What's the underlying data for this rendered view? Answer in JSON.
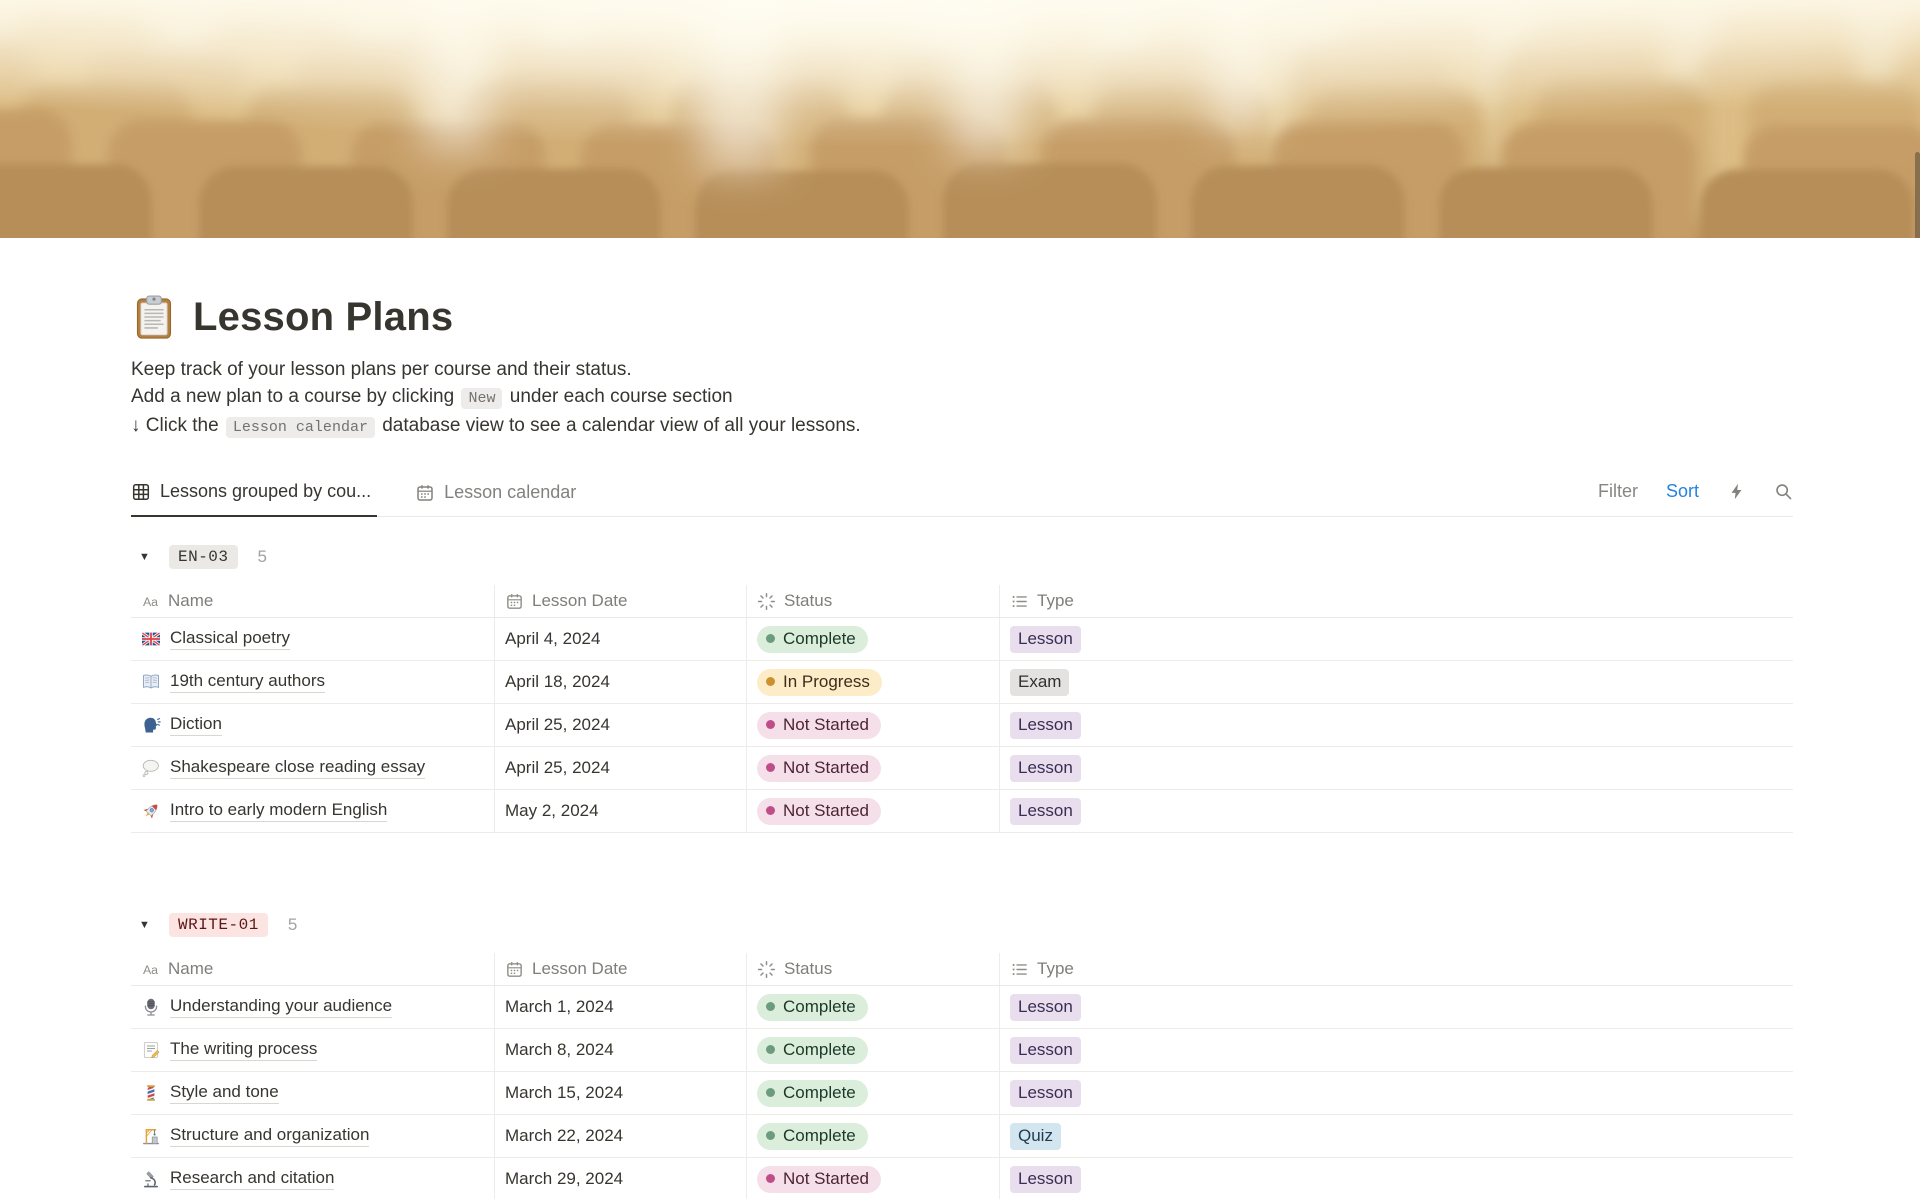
{
  "page": {
    "icon": "clipboard",
    "title": "Lesson Plans",
    "description": [
      [
        {
          "t": "Keep track of your lesson plans per course and their status."
        }
      ],
      [
        {
          "t": "Add a new plan to a course by clicking "
        },
        {
          "c": "New"
        },
        {
          "t": " under each course section"
        }
      ],
      [
        {
          "t": "↓ Click the "
        },
        {
          "c": "Lesson calendar"
        },
        {
          "t": " database view to see a calendar view of all your lessons."
        }
      ]
    ]
  },
  "view_tabs": [
    {
      "label": "Lessons grouped by cou...",
      "icon": "table-icon",
      "active": true
    },
    {
      "label": "Lesson calendar",
      "icon": "calendar-icon",
      "active": false
    }
  ],
  "toolbar": {
    "filter_label": "Filter",
    "sort_label": "Sort",
    "sort_color": "#2383E2",
    "action_icons": [
      "bolt-icon",
      "search-icon"
    ]
  },
  "table_columns": [
    {
      "label": "Name",
      "icon": "text-icon"
    },
    {
      "label": "Lesson Date",
      "icon": "calendar-icon"
    },
    {
      "label": "Status",
      "icon": "status-icon"
    },
    {
      "label": "Type",
      "icon": "list-icon"
    }
  ],
  "status_styles": {
    "Complete": {
      "bg": "#DBEDDB",
      "dot": "#6C9B7D",
      "text": "#1C3829"
    },
    "In Progress": {
      "bg": "#FDECC8",
      "dot": "#CB912F",
      "text": "#402C1B"
    },
    "Not Started": {
      "bg": "#F5E0E9",
      "dot": "#C14C8A",
      "text": "#4C2337"
    }
  },
  "type_styles": {
    "Lesson": {
      "bg": "#E8DEEE",
      "text": "#3D2C52"
    },
    "Exam": {
      "bg": "#E3E2E0",
      "text": "#32302C"
    },
    "Quiz": {
      "bg": "#D3E5EF",
      "text": "#1D3B52"
    }
  },
  "groups": [
    {
      "name": "EN-03",
      "chip_bg": "#EAE9E6",
      "chip_color": "#37352F",
      "count": "5",
      "rows": [
        {
          "icon": "flag-uk-emoji",
          "name": "Classical poetry",
          "date": "April 4, 2024",
          "status": "Complete",
          "type": "Lesson"
        },
        {
          "icon": "open-book-emoji",
          "name": "19th century authors",
          "date": "April 18, 2024",
          "status": "In Progress",
          "type": "Exam"
        },
        {
          "icon": "speaking-head-emoji",
          "name": "Diction",
          "date": "April 25, 2024",
          "status": "Not Started",
          "type": "Lesson"
        },
        {
          "icon": "thought-balloon-emoji",
          "name": "Shakespeare close reading essay",
          "date": "April 25, 2024",
          "status": "Not Started",
          "type": "Lesson"
        },
        {
          "icon": "rocket-emoji",
          "name": "Intro to early modern English",
          "date": "May 2, 2024",
          "status": "Not Started",
          "type": "Lesson"
        }
      ]
    },
    {
      "name": "WRITE-01",
      "chip_bg": "#FBE4E1",
      "chip_color": "#5D1715",
      "count": "5",
      "rows": [
        {
          "icon": "microphone-emoji",
          "name": "Understanding your audience",
          "date": "March 1, 2024",
          "status": "Complete",
          "type": "Lesson"
        },
        {
          "icon": "memo-emoji",
          "name": "The writing process",
          "date": "March 8, 2024",
          "status": "Complete",
          "type": "Lesson"
        },
        {
          "icon": "barber-pole-emoji",
          "name": "Style and tone",
          "date": "March 15, 2024",
          "status": "Complete",
          "type": "Lesson"
        },
        {
          "icon": "crane-emoji",
          "name": "Structure and organization",
          "date": "March 22, 2024",
          "status": "Complete",
          "type": "Quiz"
        },
        {
          "icon": "microscope-emoji",
          "name": "Research and citation",
          "date": "March 29, 2024",
          "status": "Not Started",
          "type": "Lesson"
        }
      ]
    }
  ]
}
